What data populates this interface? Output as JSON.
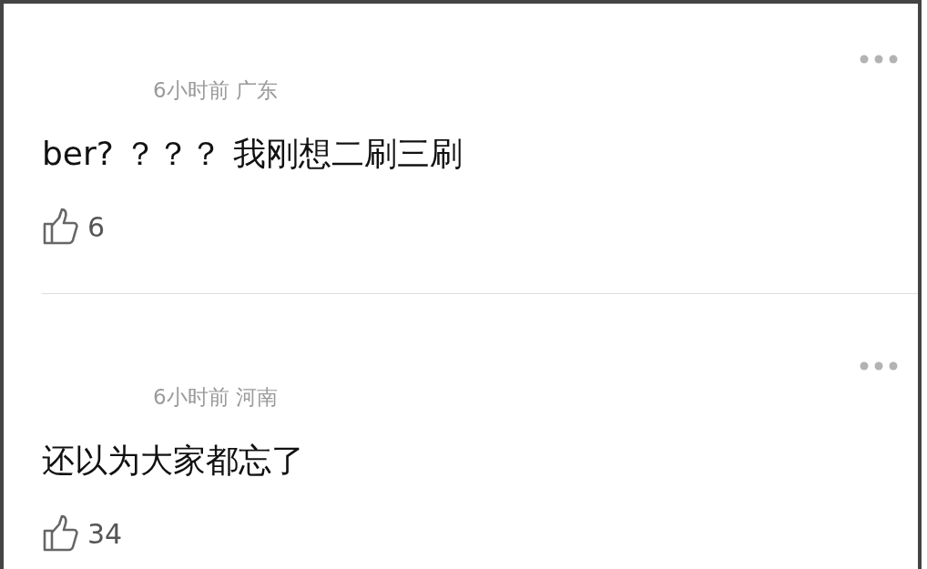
{
  "comments": [
    {
      "meta": "6小时前 广东",
      "text": "ber? ？？？ 我刚想二刷三刷",
      "likes": "6"
    },
    {
      "meta": "6小时前 河南",
      "text": "还以为大家都忘了",
      "likes": "34"
    }
  ]
}
